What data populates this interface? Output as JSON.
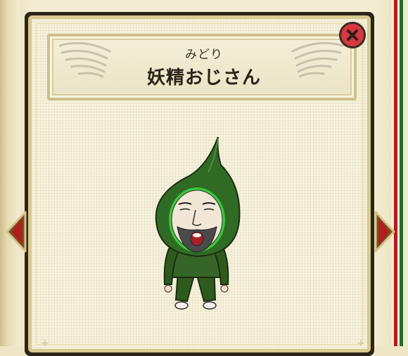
{
  "card": {
    "subtitle": "みどり",
    "title": "妖精おじさん"
  },
  "icons": {
    "close": "close-icon",
    "prev": "arrow-left-icon",
    "next": "arrow-right-icon",
    "wing": "wing-icon"
  },
  "colors": {
    "close_button": "#d8383f",
    "arrow": "#b21e1e",
    "character_hood": "#2f6b25",
    "frame_gold": "#d8c98f"
  }
}
